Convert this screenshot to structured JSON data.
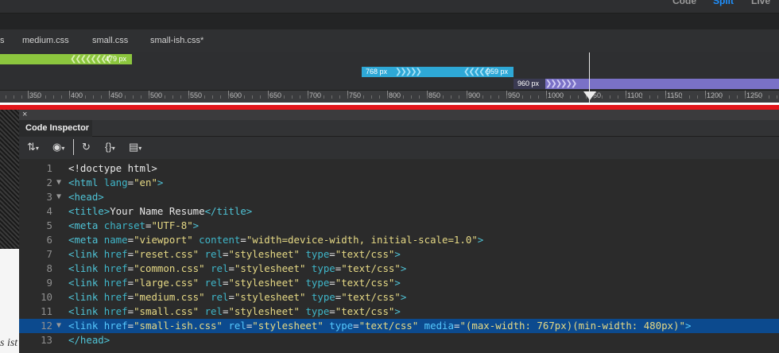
{
  "topbar": {
    "view_code": "Code",
    "view_split": "Split",
    "view_live": "Live"
  },
  "file_tabs": [
    "s",
    "medium.css",
    "small.css",
    "small-ish.css*"
  ],
  "media_queries": {
    "small": {
      "max_label": "479 px"
    },
    "medium": {
      "min_label": "768 px",
      "max_label": "959 px"
    },
    "large": {
      "min_label": "960 px"
    }
  },
  "ruler": {
    "labels": [
      "350",
      "400",
      "450",
      "500",
      "550",
      "600",
      "650",
      "700",
      "750",
      "800",
      "850",
      "900",
      "950",
      "1000",
      "1100",
      "1150",
      "1200",
      "1250"
    ],
    "partial_label": "50"
  },
  "left_background_text": "s ist",
  "panel": {
    "close": "×",
    "title": "Code Inspector"
  },
  "toolbar": {
    "file_mgmt_icon": "⇅",
    "preview_icon": "◉",
    "refresh_icon": "↻",
    "code_nav_icon": "{}",
    "options_icon": "▤"
  },
  "code_lines": [
    {
      "n": "1",
      "fold": "",
      "html": "<span class='p'>&lt;!doctype html&gt;</span>"
    },
    {
      "n": "2",
      "fold": "▼",
      "html": "<span class='t'>&lt;html </span><span class='a'>lang</span><span class='p'>=</span><span class='v'>\"en\"</span><span class='t'>&gt;</span>"
    },
    {
      "n": "3",
      "fold": "▼",
      "html": "<span class='t'>&lt;head&gt;</span>"
    },
    {
      "n": "4",
      "fold": "",
      "html": "<span class='t'>&lt;title&gt;</span><span class='p'>Your Name Resume</span><span class='t'>&lt;/title&gt;</span>"
    },
    {
      "n": "5",
      "fold": "",
      "html": "<span class='t'>&lt;meta </span><span class='a'>charset</span><span class='p'>=</span><span class='v'>\"UTF-8\"</span><span class='t'>&gt;</span>"
    },
    {
      "n": "6",
      "fold": "",
      "html": "<span class='t'>&lt;meta </span><span class='a'>name</span><span class='p'>=</span><span class='v'>\"viewport\"</span><span class='a'> content</span><span class='p'>=</span><span class='v'>\"width=device-width, initial-scale=1.0\"</span><span class='t'>&gt;</span>"
    },
    {
      "n": "7",
      "fold": "",
      "html": "<span class='t'>&lt;link </span><span class='a'>href</span><span class='p'>=</span><span class='v'>\"reset.css\"</span><span class='a'> rel</span><span class='p'>=</span><span class='v'>\"stylesheet\"</span><span class='a'> type</span><span class='p'>=</span><span class='v'>\"text/css\"</span><span class='t'>&gt;</span>"
    },
    {
      "n": "8",
      "fold": "",
      "html": "<span class='t'>&lt;link </span><span class='a'>href</span><span class='p'>=</span><span class='v'>\"common.css\"</span><span class='a'> rel</span><span class='p'>=</span><span class='v'>\"stylesheet\"</span><span class='a'> type</span><span class='p'>=</span><span class='v'>\"text/css\"</span><span class='t'>&gt;</span>"
    },
    {
      "n": "9",
      "fold": "",
      "html": "<span class='t'>&lt;link </span><span class='a'>href</span><span class='p'>=</span><span class='v'>\"large.css\"</span><span class='a'> rel</span><span class='p'>=</span><span class='v'>\"stylesheet\"</span><span class='a'> type</span><span class='p'>=</span><span class='v'>\"text/css\"</span><span class='t'>&gt;</span>"
    },
    {
      "n": "10",
      "fold": "",
      "html": "<span class='t'>&lt;link </span><span class='a'>href</span><span class='p'>=</span><span class='v'>\"medium.css\"</span><span class='a'> rel</span><span class='p'>=</span><span class='v'>\"stylesheet\"</span><span class='a'> type</span><span class='p'>=</span><span class='v'>\"text/css\"</span><span class='t'>&gt;</span>"
    },
    {
      "n": "11",
      "fold": "",
      "html": "<span class='t'>&lt;link </span><span class='a'>href</span><span class='p'>=</span><span class='v'>\"small.css\"</span><span class='a'> rel</span><span class='p'>=</span><span class='v'>\"stylesheet\"</span><span class='a'> type</span><span class='p'>=</span><span class='v'>\"text/css\"</span><span class='t'>&gt;</span>"
    },
    {
      "n": "12",
      "fold": "▼",
      "sel": true,
      "html": "<span class='t'>&lt;link </span><span class='a'>href</span><span class='p'>=</span><span class='v'>\"small-ish.css\"</span><span class='a'> rel</span><span class='p'>=</span><span class='v'>\"stylesheet\"</span><span class='a'> type</span><span class='p'>=</span><span class='v'>\"text/css\"</span><span class='a'> media</span><span class='p'>=</span><span class='v'>\"(max-width: 767px)(min-width: 480px)\"</span><span class='t'>&gt;</span>"
    },
    {
      "n": "13",
      "fold": "",
      "html": "<span class='t'>&lt;/head&gt;</span>"
    }
  ]
}
